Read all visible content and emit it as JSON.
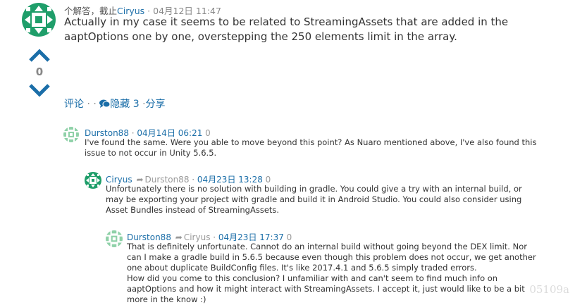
{
  "answer": {
    "author_prefix": "个解答，截止",
    "author": "Ciryus",
    "date_sep": " · ",
    "date": "04月12日 11:47",
    "text": "Actually in my case it seems to be related to StreamingAssets that are added in the aaptOptions one by one, overstepping the 250 elements limit in the array.",
    "vote_count": "0",
    "actions": {
      "comment": "评论",
      "dots": "· ·",
      "hidden": "隐藏 3",
      "share_sep": "·",
      "share": "分享"
    }
  },
  "comments": [
    {
      "author": "Durston88",
      "sep": " · ",
      "date": "04月14日 06:21",
      "votes": "0",
      "text": "I've found the same. Were you able to move beyond this point? As Nuaro mentioned above, I've also found this issue to not occur in Unity 5.6.5."
    },
    {
      "author": "Ciryus",
      "reply_to": "Durston88",
      "sep": " · ",
      "date": "04月23日 13:28",
      "votes": "0",
      "text": "Unfortunately there is no solution with building in gradle. You could give a try with an internal build, or may be exporting your project with gradle and build it in Android Studio. You could also consider using Asset Bundles instead of StreamingAssets."
    },
    {
      "author": "Durston88",
      "reply_to": "Ciryus",
      "sep": " · ",
      "date": "04月23日 17:37",
      "votes": "0",
      "text": "That is definitely unfortunate. Cannot do an internal build without going beyond the DEX limit. Nor can I make a gradle build in 5.6.5 because even though this problem does not occur, we get another one about duplicate BuildConfig files. It's like 2017.4.1 and 5.6.5 simply traded errors.",
      "text2": "How did you come to this conclusion? I unfamiliar with and can't seem to find much info on aaptOptions and how it might interact with StreamingAssets. I accept it, just would like to be a bit more in the know :)"
    }
  ],
  "watermark": "05109a",
  "colors": {
    "link": "#1b6ea8",
    "vote_arrow": "#1b6ea8",
    "ciryus_avatar": "#1f9e6a",
    "durston_avatar": "#8fd1a8"
  },
  "icons": {
    "vote_up": "chevron-up-icon",
    "vote_down": "chevron-down-icon",
    "reply": "reply-arrow-icon",
    "comment_bubble": "comments-icon"
  }
}
